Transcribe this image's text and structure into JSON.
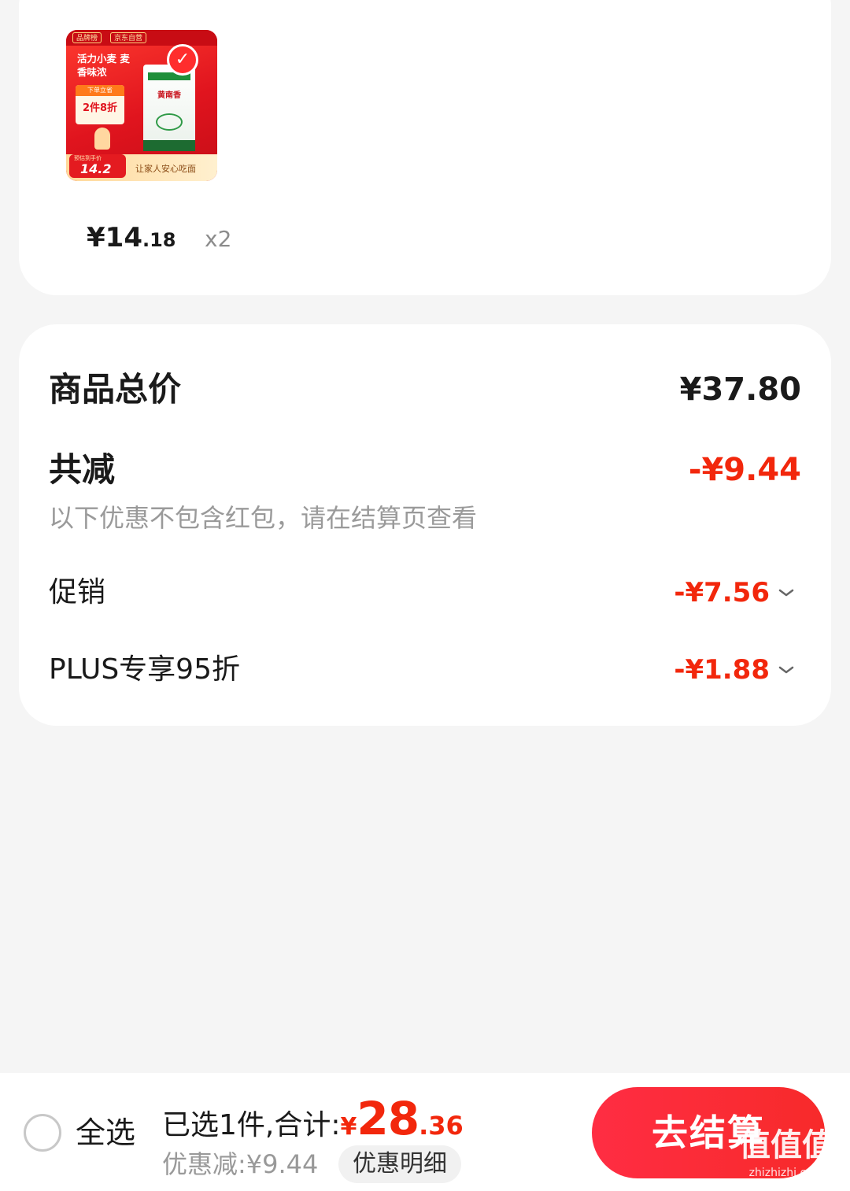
{
  "product": {
    "image": {
      "brand_tag_1": "品牌榜",
      "brand_tag_2": "京东自营",
      "slogan": "活力小麦 麦香味浓",
      "promo_header": "下单立省",
      "promo_value": "2件8折",
      "bag_name": "黄南香",
      "price_chip_label": "预估到手价",
      "price_chip_value": "14.2",
      "tagline": "让家人安心吃面",
      "check_mark": "✓"
    },
    "price_main": "¥14",
    "price_decimal": ".18",
    "quantity": "x2"
  },
  "summary": {
    "total_label": "商品总价",
    "total_value": "¥37.80",
    "discount_label": "共减",
    "discount_value": "-¥9.44",
    "discount_note": "以下优惠不包含红包，请在结算页查看",
    "promo_label": "促销",
    "promo_value": "-¥7.56",
    "plus_label": "PLUS专享95折",
    "plus_value": "-¥1.88"
  },
  "bottom_bar": {
    "select_all": "全选",
    "selected_prefix": "已选1件,合计:",
    "total_yen": "¥",
    "total_int": "28",
    "total_dec": ".36",
    "saved": "优惠减:¥9.44",
    "detail_button": "优惠明细",
    "checkout_button": "去结算",
    "watermark_big": "值值值",
    "watermark_small": "zhizhizhi.com"
  },
  "colors": {
    "accent_red": "#f2270c",
    "background": "#f5f5f5"
  },
  "icons": {
    "chevron": "chevron-down-icon",
    "radio": "radio-unchecked-icon"
  }
}
